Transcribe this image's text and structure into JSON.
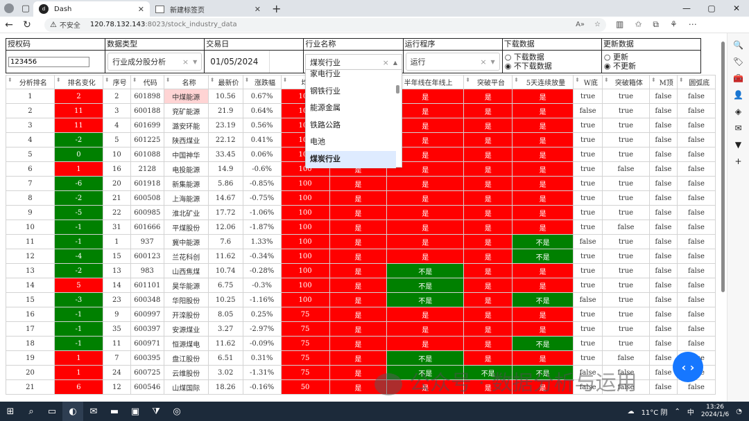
{
  "browser": {
    "tabs": [
      {
        "label": "Dash",
        "favicon": "dash-logo-icon"
      },
      {
        "label": "新建标签页",
        "favicon": "new-tab-icon"
      }
    ],
    "url": {
      "security": "不安全",
      "host": "120.78.132.143",
      "path": ":8023/stock_industry_data"
    }
  },
  "controls": {
    "auth": {
      "label": "授权码",
      "value": "123456"
    },
    "datatype": {
      "label": "数据类型",
      "value": "行业成分股分析"
    },
    "date": {
      "label": "交易日",
      "value": "01/05/2024"
    },
    "industry": {
      "label": "行业名称",
      "value": "煤炭行业",
      "options": [
        "家电行业",
        "钢铁行业",
        "能源金属",
        "铁路公路",
        "电池",
        "煤炭行业"
      ]
    },
    "program": {
      "label": "运行程序",
      "value": "运行"
    },
    "download": {
      "label": "下载数据",
      "opts": [
        "下载数据",
        "不下载数据"
      ],
      "selected": "不下载数据"
    },
    "update": {
      "label": "更新数据",
      "opts": [
        "更新",
        "不更新"
      ],
      "selected": "不更新"
    }
  },
  "columns": [
    "分析排名",
    "排名变化",
    "序号",
    "代码",
    "名称",
    "最新价",
    "涨跌幅",
    "均线",
    "",
    "半年线在年线上",
    "突破平台",
    "5天连续放量",
    "W底",
    "突破箱体",
    "M顶",
    "圆弧底"
  ],
  "rows": [
    [
      "1",
      "2",
      "2",
      "601898",
      "中煤能源",
      "10.56",
      "0.67%",
      "100",
      "是",
      "是",
      "是",
      "是",
      "true",
      "true",
      "false",
      "false"
    ],
    [
      "2",
      "11",
      "3",
      "600188",
      "兖矿能源",
      "21.9",
      "0.64%",
      "100",
      "是",
      "是",
      "是",
      "是",
      "false",
      "true",
      "false",
      "false"
    ],
    [
      "3",
      "11",
      "4",
      "601699",
      "潞安环能",
      "23.19",
      "0.56%",
      "100",
      "是",
      "是",
      "是",
      "是",
      "true",
      "true",
      "false",
      "false"
    ],
    [
      "4",
      "-2",
      "5",
      "601225",
      "陕西煤业",
      "22.12",
      "0.41%",
      "100",
      "是",
      "是",
      "是",
      "是",
      "true",
      "true",
      "false",
      "false"
    ],
    [
      "5",
      "0",
      "10",
      "601088",
      "中国神华",
      "33.45",
      "0.06%",
      "100",
      "是",
      "是",
      "是",
      "是",
      "true",
      "true",
      "false",
      "false"
    ],
    [
      "6",
      "1",
      "16",
      "2128",
      "电投能源",
      "14.9",
      "-0.6%",
      "100",
      "是",
      "是",
      "是",
      "是",
      "true",
      "false",
      "false",
      "false"
    ],
    [
      "7",
      "-6",
      "20",
      "601918",
      "新集能源",
      "5.86",
      "-0.85%",
      "100",
      "是",
      "是",
      "是",
      "是",
      "true",
      "true",
      "false",
      "false"
    ],
    [
      "8",
      "-2",
      "21",
      "600508",
      "上海能源",
      "14.67",
      "-0.75%",
      "100",
      "是",
      "是",
      "是",
      "是",
      "true",
      "true",
      "false",
      "false"
    ],
    [
      "9",
      "-5",
      "22",
      "600985",
      "淮北矿业",
      "17.72",
      "-1.06%",
      "100",
      "是",
      "是",
      "是",
      "是",
      "true",
      "true",
      "false",
      "false"
    ],
    [
      "10",
      "-1",
      "31",
      "601666",
      "平煤股份",
      "12.06",
      "-1.87%",
      "100",
      "是",
      "是",
      "是",
      "是",
      "true",
      "false",
      "false",
      "false"
    ],
    [
      "11",
      "-1",
      "1",
      "937",
      "冀中能源",
      "7.6",
      "1.33%",
      "100",
      "是",
      "是",
      "是",
      "不是",
      "false",
      "true",
      "false",
      "false"
    ],
    [
      "12",
      "-4",
      "15",
      "600123",
      "兰花科创",
      "11.62",
      "-0.34%",
      "100",
      "是",
      "是",
      "是",
      "不是",
      "true",
      "true",
      "false",
      "false"
    ],
    [
      "13",
      "-2",
      "13",
      "983",
      "山西焦煤",
      "10.74",
      "-0.28%",
      "100",
      "是",
      "不是",
      "是",
      "是",
      "true",
      "true",
      "false",
      "false"
    ],
    [
      "14",
      "5",
      "14",
      "601101",
      "昊华能源",
      "6.75",
      "-0.3%",
      "100",
      "是",
      "不是",
      "是",
      "是",
      "true",
      "true",
      "false",
      "false"
    ],
    [
      "15",
      "-3",
      "23",
      "600348",
      "华阳股份",
      "10.25",
      "-1.16%",
      "100",
      "是",
      "不是",
      "是",
      "不是",
      "false",
      "true",
      "false",
      "false"
    ],
    [
      "16",
      "-1",
      "9",
      "600997",
      "开滦股份",
      "8.05",
      "0.25%",
      "75",
      "是",
      "是",
      "是",
      "是",
      "true",
      "true",
      "false",
      "false"
    ],
    [
      "17",
      "-1",
      "35",
      "600397",
      "安源煤业",
      "3.27",
      "-2.97%",
      "75",
      "是",
      "是",
      "是",
      "是",
      "true",
      "true",
      "false",
      "false"
    ],
    [
      "18",
      "-1",
      "11",
      "600971",
      "恒源煤电",
      "11.62",
      "-0.09%",
      "75",
      "是",
      "是",
      "是",
      "不是",
      "true",
      "true",
      "false",
      "false"
    ],
    [
      "19",
      "1",
      "7",
      "600395",
      "盘江股份",
      "6.51",
      "0.31%",
      "75",
      "是",
      "不是",
      "是",
      "是",
      "true",
      "false",
      "false",
      "false"
    ],
    [
      "20",
      "1",
      "24",
      "600725",
      "云维股份",
      "3.02",
      "-1.31%",
      "75",
      "是",
      "不是",
      "不是",
      "不是",
      "false",
      "false",
      "false",
      "false"
    ],
    [
      "21",
      "6",
      "12",
      "600546",
      "山煤国际",
      "18.26",
      "-0.16%",
      "50",
      "是",
      "是",
      "是",
      "是",
      "false",
      "false",
      "false",
      "false"
    ]
  ],
  "watermark": "公众号 · 数据分析与运用",
  "taskbar": {
    "weather": "11°C 阴",
    "ime": "中",
    "time": "13:26",
    "date": "2024/1/6"
  },
  "colors": {
    "red": "#ff0000",
    "green": "#008000",
    "pink": "#ffd4d4"
  }
}
